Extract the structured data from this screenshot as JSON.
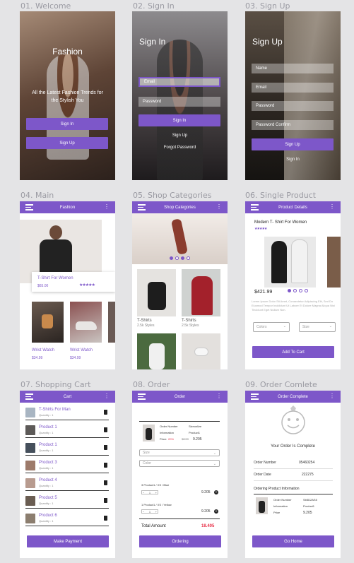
{
  "captions": [
    "01. Welcome",
    "02. Sign In",
    "03. Sign Up",
    "04. Main",
    "05. Shop Categories",
    "06. Single Product",
    "07. Shopping Cart",
    "08. Order",
    "09. Order Comlete"
  ],
  "welcome": {
    "title": "Fashion",
    "tagline": "All the Latest Fashion Trends for the Stylish You",
    "sign_in": "Sign In",
    "sign_up": "Sign Up"
  },
  "signin": {
    "title": "Sign In",
    "email_ph": "Email",
    "password_ph": "Password",
    "sign_in": "Sign In",
    "sign_up": "Sign Up",
    "forgot": "Forgot Password"
  },
  "signup": {
    "title": "Sign Up",
    "name_ph": "Name",
    "email_ph": "Email",
    "password_ph": "Password",
    "confirm_ph": "Password Confirm",
    "sign_up": "Sign Up",
    "sign_in": "Sign In"
  },
  "main": {
    "header": "Fashion",
    "featured_name": "T-Shirt For Women",
    "featured_price": "$65.00",
    "rating": "★★★★★",
    "items": [
      {
        "name": "Wrist Watch",
        "price": "$34.99"
      },
      {
        "name": "Wrist Watch",
        "price": "$34.99"
      }
    ]
  },
  "categories": {
    "header": "Shop Categories",
    "items": [
      {
        "name": "T-Shirts",
        "sub": "2.5k Styles"
      },
      {
        "name": "T-Shirts",
        "sub": "2.5k Styles"
      }
    ]
  },
  "product": {
    "header": "Product Details",
    "name": "Modern T- Shirt For Women",
    "rating": "★★★★★",
    "price": "$421.99",
    "desc": "Lorem Ipsum Dolor Sit Amet, Consectetur Adipiscing Elit, Sed Do Eiusmod Tempor Incididunt Ut Labore Et Dolore Magna Aliqua Nisi Tincidunt Eget Nullam Non.",
    "colors_ph": "Colors",
    "size_ph": "Size",
    "add_to_cart": "Add To Cart"
  },
  "cart": {
    "header": "Cart",
    "items": [
      {
        "name": "T-Shirts For Man",
        "qty": "Quantity : 1"
      },
      {
        "name": "Product 1",
        "qty": "Quantity : 1"
      },
      {
        "name": "Product 1",
        "qty": "Quantity : 1"
      },
      {
        "name": "Product 3",
        "qty": "Quantity : 1"
      },
      {
        "name": "Product 4",
        "qty": "Quantity : 1"
      },
      {
        "name": "Product 5",
        "qty": "Quantity : 1"
      },
      {
        "name": "Product 6",
        "qty": "Quantity : 1"
      }
    ],
    "make_payment": "Make Payment"
  },
  "order": {
    "header": "Order",
    "number_label": "Order Number",
    "number_value": "Sizeonlize",
    "info_label": "Information",
    "info_value": "Product1",
    "price_label": "Price:",
    "discount": "20%",
    "old_price": "$8.99",
    "price": "9.205",
    "size_ph": "Size",
    "color_ph": "Color",
    "lines": [
      {
        "name": "3 Product1 / XS / Blue",
        "qty": "1",
        "price": "9.205"
      },
      {
        "name": "1 Product1 / XS / Yellow",
        "qty": "1",
        "price": "9.205"
      }
    ],
    "total_label": "Total Amount",
    "total_value": "18.405",
    "ordering": "Ordering"
  },
  "complete": {
    "header": "Order Complete",
    "message": "Your Order Is Complete",
    "order_number_label": "Order Number",
    "order_number": "05460254",
    "order_date_label": "Order Date",
    "order_date": "222275",
    "info_title": "Ordering Product Information",
    "d_number_label": "Order Number",
    "d_number": "Sb5D2AS5",
    "d_info_label": "Information",
    "d_info": "Product1",
    "d_price_label": "Price",
    "d_price": "9.205",
    "go_home": "Go Home"
  },
  "icons": [
    "hamburger-icon",
    "kebab-icon",
    "trash-icon",
    "plus-icon",
    "smiley-icon",
    "chevron-down-icon"
  ],
  "colors": {
    "accent": "#7d57c9",
    "price_red": "#e8334a"
  }
}
